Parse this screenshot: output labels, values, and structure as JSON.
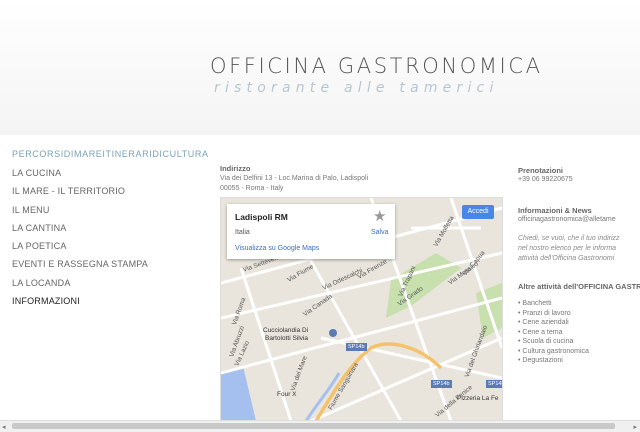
{
  "header": {
    "title": "OFFICINA GASTRONOMICA",
    "subtitle": "ristorante alle tamerici"
  },
  "sidebar": {
    "tagline": "PERCORSIDIMAREITINERARIDICULTURA",
    "items": [
      {
        "label": "LA CUCINA"
      },
      {
        "label": "IL MARE - IL TERRITORIO"
      },
      {
        "label": "IL MENU"
      },
      {
        "label": "LA CANTINA"
      },
      {
        "label": "LA POETICA"
      },
      {
        "label": "EVENTI E RASSEGNA STAMPA"
      },
      {
        "label": "LA LOCANDA"
      },
      {
        "label": "INFORMAZIONI"
      }
    ]
  },
  "address": {
    "heading": "Indirizzo",
    "line1": "Via dei Delfini 13 - Loc.Marina di Palo, Ladispoli",
    "line2": "00055 - Roma - Italy"
  },
  "map": {
    "place": "Ladispoli RM",
    "country": "Italia",
    "link": "Visualizza su Google Maps",
    "save": "Salva",
    "signin": "Accedi",
    "labels": [
      "Via Molfetta",
      "Via Capua",
      "Via Messico",
      "Via Trapani",
      "Via Fiume",
      "Via Odescalchi",
      "Via Firenze",
      "Via Canada",
      "Via Settevene Palo Nuova",
      "Via Roma",
      "Via Abruzzi",
      "Via Lazio",
      "Cucciolandia Di",
      "Bartolotti Silvia",
      "Via del Mare",
      "Via del Ghirlandaio",
      "Pizzeria La Fe",
      "Via della Fenice",
      "Fiume Sanguinara",
      "Via Grado",
      "Four X"
    ],
    "roads": [
      "SP14b",
      "SP14b",
      "SP14b"
    ],
    "colors": {
      "land": "#e9e5dc",
      "road": "#ffffff",
      "park": "#c8dfae",
      "water": "#a5c0ee"
    }
  },
  "right": {
    "prenotazioni": "Prenotazioni",
    "phone": "+39 06 99220675",
    "info_heading": "Informazioni & News",
    "email": "officinagastronomica@alletame",
    "promo": [
      "Chiedi, se vuoi, che il tuo indirizz",
      "nel nostro elenco per le informa",
      "attività dell'Officina Gastronomi"
    ],
    "services_heading": "Altre attività dell'OFFICINA GASTRO",
    "services": [
      "• Banchetti",
      "• Pranzi di lavoro",
      "• Cene aziendali",
      "• Cene a tema",
      "• Scuola di cucina",
      "• Cultura gastronomica",
      "• Degustazioni"
    ]
  },
  "scrollbar": {
    "left": "◂",
    "right": "▸"
  }
}
